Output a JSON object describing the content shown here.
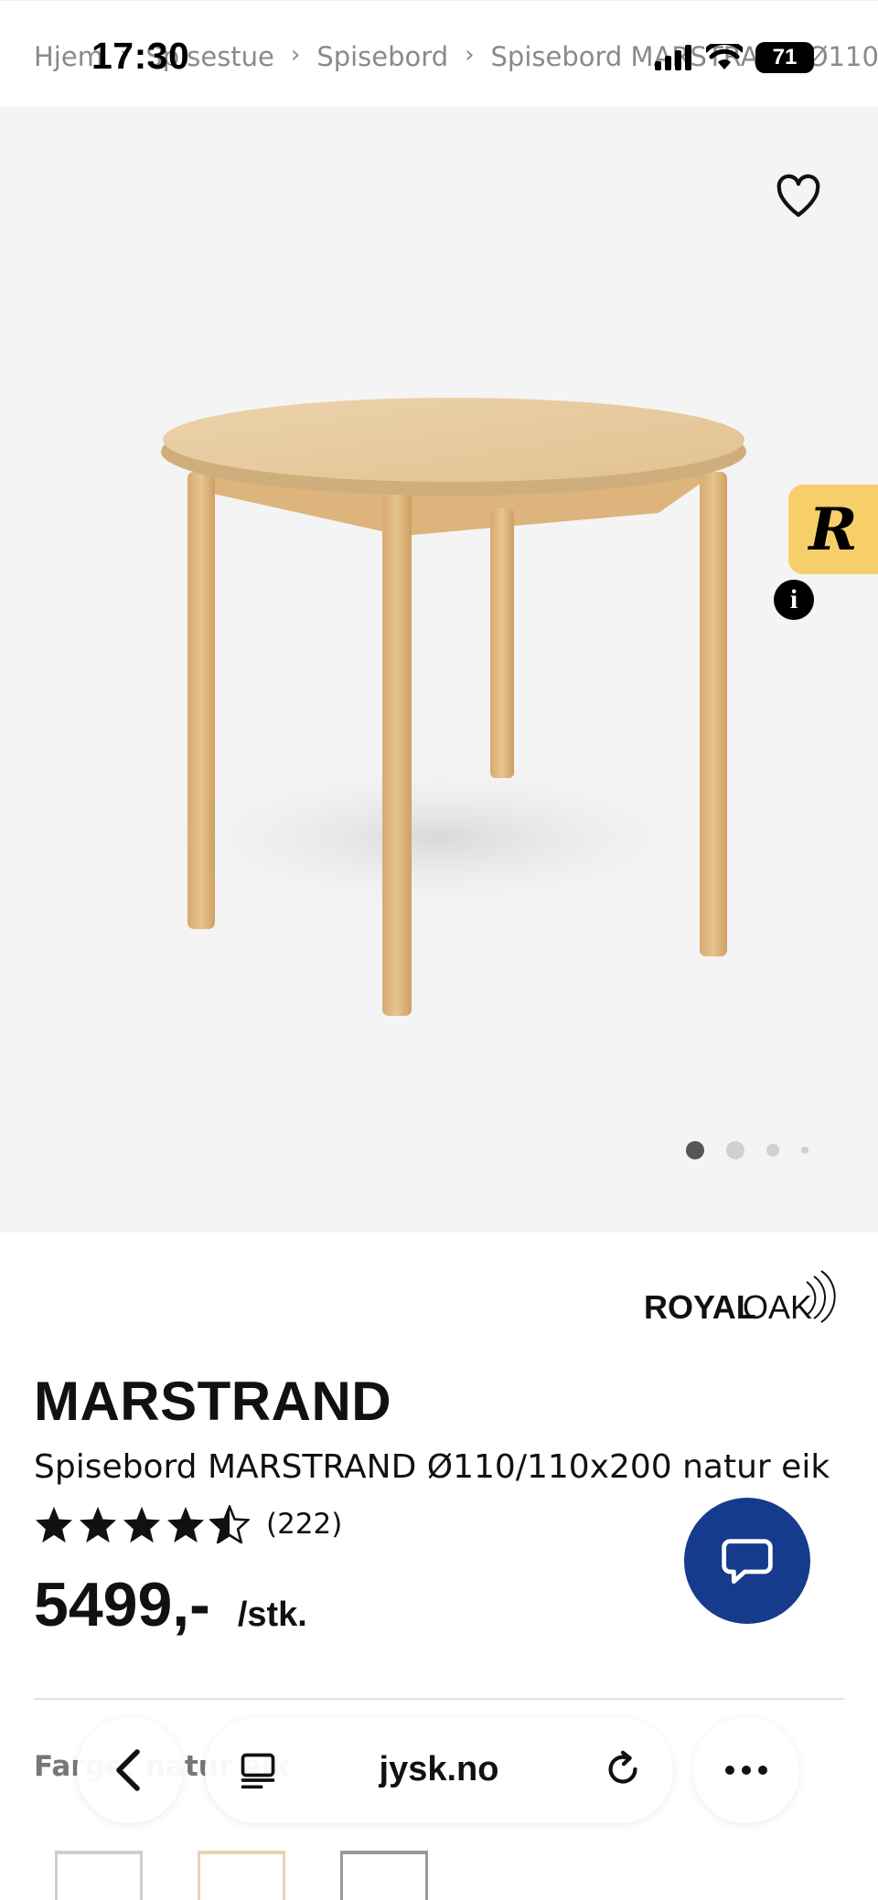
{
  "status": {
    "time": "17:30",
    "battery": "71"
  },
  "breadcrumb": [
    "Hjem",
    "Spisestue",
    "Spisebord",
    "Spisebord MARSTRAND Ø110"
  ],
  "gallery": {
    "dots": 4,
    "active_index": 0
  },
  "badge": {
    "info": "i",
    "letter": "R"
  },
  "product": {
    "brand": "ROYALOAK",
    "brand_part1": "ROYAL",
    "brand_part2": "OAK",
    "title": "MARSTRAND",
    "subtitle": "Spisebord MARSTRAND Ø110/110x200 natur eik",
    "rating": 4.5,
    "reviews": "(222)",
    "price": "5499,-",
    "unit": "/stk."
  },
  "options": {
    "label": "Farge: natur eik"
  },
  "browser": {
    "url": "jysk.no"
  },
  "colors": {
    "chat": "#163a8c",
    "badge": "#f7cf6a",
    "hero_bg": "#f4f4f4"
  }
}
